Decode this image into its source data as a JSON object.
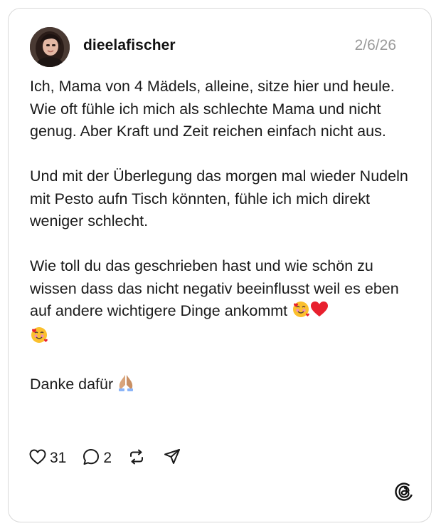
{
  "post": {
    "username": "dieelafischer",
    "date": "2/6/26",
    "paragraphs": [
      "Ich, Mama von 4 Mädels, alleine, sitze hier und heule.\nWie oft fühle ich mich als schlechte Mama und nicht genug. Aber Kraft und Zeit reichen einfach nicht aus.",
      "Und mit der Überlegung das morgen mal wieder Nudeln mit Pesto aufn Tisch könnten, fühle ich mich direkt weniger schlecht.",
      "Wie toll du das geschrieben hast und wie schön zu wissen dass das nicht negativ beeinflusst weil es eben auf andere wichtigere Dinge ankommt"
    ],
    "closing": "Danke dafür"
  },
  "actions": {
    "likes": "31",
    "replies": "2"
  },
  "icons": {
    "like": "heart-icon",
    "reply": "speech-bubble-icon",
    "repost": "repost-icon",
    "share": "send-icon",
    "brand": "threads-logo-icon",
    "emoji_1": "smiling-face-with-hearts-emoji",
    "emoji_2": "red-heart-emoji",
    "emoji_3": "folded-hands-emoji"
  },
  "colors": {
    "text": "#1a1a1a",
    "muted": "#9a9a9a",
    "border": "#d9d9d9",
    "heart": "#e8202e"
  }
}
